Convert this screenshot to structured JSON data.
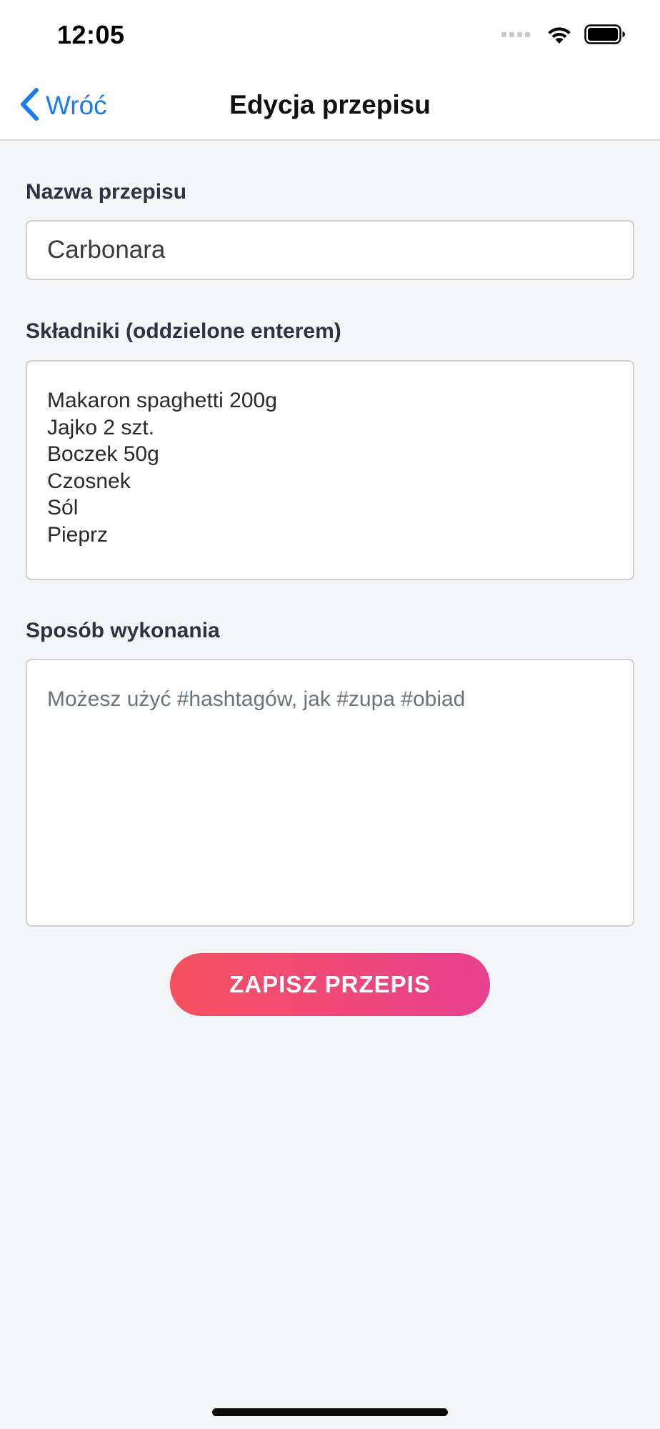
{
  "status_bar": {
    "time": "12:05",
    "icons": [
      "signal-icon",
      "wifi-icon",
      "battery-icon"
    ]
  },
  "nav": {
    "back_label": "Wróć",
    "back_icon": "chevron-left-icon",
    "title": "Edycja przepisu",
    "accent_color": "#1a7cf0"
  },
  "form": {
    "name_label": "Nazwa przepisu",
    "name_value": "Carbonara",
    "ingredients_label": "Składniki (oddzielone enterem)",
    "ingredients": [
      "Makaron spaghetti 200g",
      "Jajko 2 szt.",
      "Boczek 50g",
      "Czosnek",
      "Sól",
      "Pieprz"
    ],
    "method_label": "Sposób wykonania",
    "method_value": "",
    "method_placeholder": "Możesz użyć #hashtagów, jak #zupa #obiad"
  },
  "actions": {
    "save_label": "ZAPISZ PRZEPIS",
    "save_gradient": [
      "#f5515f",
      "#e8418f"
    ]
  }
}
